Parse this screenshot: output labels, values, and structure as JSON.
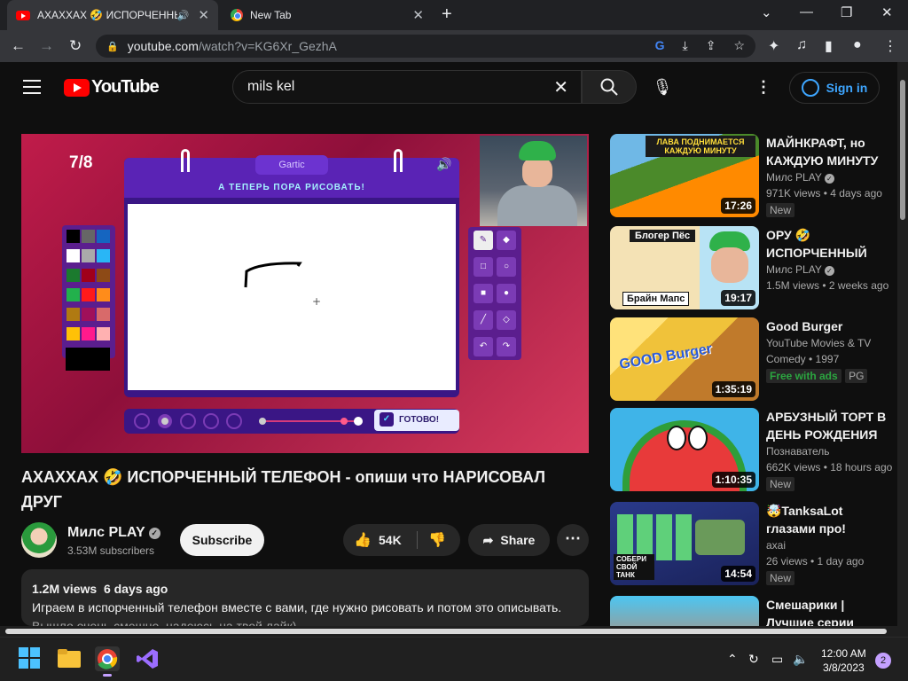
{
  "browser": {
    "tabs": [
      {
        "title": "АХАХХАХ 🤣 ИСПОРЧЕННЫЙ ТЕЛЕФОН",
        "active": true
      },
      {
        "title": "New Tab",
        "active": false
      }
    ],
    "url_host": "youtube.com",
    "url_path": "/watch?v=KG6Xr_GezhA"
  },
  "masthead": {
    "logo_text": "YouTube",
    "search_value": "mils kel",
    "signin_label": "Sign in"
  },
  "player": {
    "score": "7/8",
    "game_badge": "Gartic",
    "game_prompt": "А ТЕПЕРЬ ПОРА РИСОВАТЬ!",
    "ready_label": "ГОТОВО!"
  },
  "video": {
    "title": "АХАХХАХ 🤣 ИСПОРЧЕННЫЙ ТЕЛЕФОН - опиши что НАРИСОВАЛ ДРУГ",
    "channel": "Милс PLAY",
    "subscribers": "3.53M subscribers",
    "subscribe_label": "Subscribe",
    "likes": "54K",
    "share_label": "Share",
    "views": "1.2M views",
    "age": "6 days ago",
    "description_line1": "Играем в испорченный телефон вместе с вами, где нужно рисовать и потом это описывать.",
    "description_line2": "Вышло очень смешно, надеюсь на твой лайк)"
  },
  "recommendations": [
    {
      "title": "МАЙНКРАФТ, но КАЖДУЮ МИНУТУ ЛАВА ПОДНИМАЕТСЯ",
      "channel": "Милс PLAY",
      "verified": true,
      "meta": "971K views • 4 days ago",
      "badge": "New",
      "duration": "17:26",
      "thumb_text": "ЛАВА ПОДНИМАЕТСЯ КАЖДУЮ МИНУТУ",
      "colors": [
        "#4b8a2a",
        "#ff8a00"
      ]
    },
    {
      "title": "ОРУ 🤣 ИСПОРЧЕННЫЙ ТЕЛЕФОН",
      "channel": "Милс PLAY",
      "verified": true,
      "meta": "1.5M views • 2 weeks ago",
      "badge": "",
      "duration": "19:17",
      "thumb_text": "Блогер Пёс",
      "thumb_text2": "Брайн Мапс",
      "colors": [
        "#b8e3f5",
        "#f4e2b5"
      ]
    },
    {
      "title": "Good Burger",
      "channel": "YouTube Movies & TV",
      "verified": false,
      "meta": "Comedy • 1997",
      "badge": "Free with ads",
      "badge2": "PG",
      "duration": "1:35:19",
      "thumb_text": "GOOD Burger",
      "colors": [
        "#f0c23a",
        "#c07a2b"
      ]
    },
    {
      "title": "АРБУЗНЫЙ ТОРТ В ДЕНЬ РОЖДЕНИЯ",
      "channel": "Познаватель",
      "verified": false,
      "meta": "662K views • 18 hours ago",
      "badge": "New",
      "duration": "1:10:35",
      "thumb_text": "",
      "colors": [
        "#3fb4e8",
        "#e83a3a"
      ]
    },
    {
      "title": "🤯TanksaLot глазами про!",
      "channel": "axai",
      "verified": false,
      "meta": "26 views • 1 day ago",
      "badge": "New",
      "duration": "14:54",
      "thumb_text": "СОБЕРИ СВОЙ ТАНК",
      "colors": [
        "#2a3a8a",
        "#5fd07a"
      ]
    },
    {
      "title": "Смешарики | Лучшие серии",
      "channel": "",
      "verified": false,
      "meta": "",
      "badge": "",
      "duration": "",
      "thumb_text": "",
      "colors": [
        "#4cc6f2",
        "#f26a2a"
      ]
    }
  ],
  "taskbar": {
    "time": "12:00 AM",
    "date": "3/8/2023",
    "notifications": "2"
  }
}
